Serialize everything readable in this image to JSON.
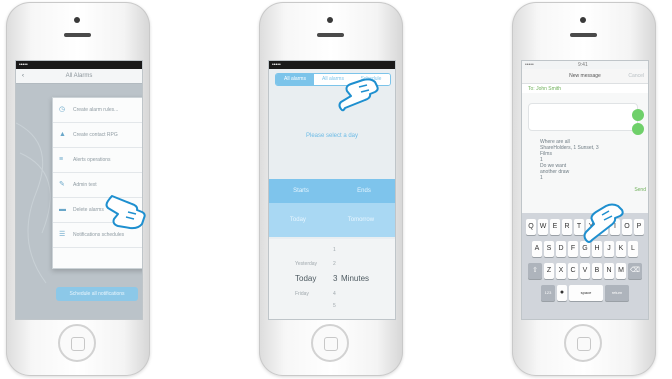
{
  "phone1": {
    "status_left": "••••• ",
    "nav_back": "‹",
    "nav_title": "All Alarms",
    "menu_items": [
      {
        "icon": "alarm-icon",
        "label": "Create alarm rules..."
      },
      {
        "icon": "person-icon",
        "label": "Create contact RPG"
      },
      {
        "icon": "alert-icon",
        "label": "Alerts operations"
      },
      {
        "icon": "edit-icon",
        "label": "Admin text"
      },
      {
        "icon": "folder-icon",
        "label": "Delete alarms"
      },
      {
        "icon": "settings-icon",
        "label": "Notifications schedules"
      }
    ],
    "bottom_button": "Schedule all notifications"
  },
  "phone2": {
    "status_left": "•••••",
    "tabs": [
      "All alarms",
      "All alarms",
      "Schedule"
    ],
    "prompt": "Please select a day",
    "band_top": {
      "left": "Starts",
      "right": "Ends"
    },
    "band_mid": {
      "left": "Today",
      "right": "Tomorrow"
    },
    "picker_rows": [
      {
        "c1": "",
        "c2": "1",
        "c3": ""
      },
      {
        "c1": "Yesterday",
        "c2": "2",
        "c3": ""
      },
      {
        "c1": "Today",
        "c2": "3",
        "c3": "Minutes"
      },
      {
        "c1": "Friday",
        "c2": "4",
        "c3": ""
      },
      {
        "c1": "",
        "c2": "5",
        "c3": ""
      }
    ]
  },
  "phone3": {
    "status_left": "•••••",
    "status_time": "9:41",
    "header_left": "",
    "header_title": "New message",
    "header_right": "Cancel",
    "to_label": "To: ",
    "to_value": "John Smith",
    "draft_text": "Where are all\nShareHolders, 1 Sunset, 3\nFilms\n1\nDo we want\nanother draw\n1",
    "send_label": "Send",
    "keyboard_rows": [
      [
        "Q",
        "W",
        "E",
        "R",
        "T",
        "Y",
        "U",
        "I",
        "O",
        "P"
      ],
      [
        "A",
        "S",
        "D",
        "F",
        "G",
        "H",
        "J",
        "K",
        "L"
      ],
      [
        "⇧",
        "Z",
        "X",
        "C",
        "V",
        "B",
        "N",
        "M",
        "⌫"
      ]
    ],
    "kb_bottom": {
      "numbers": "123",
      "space": "space",
      "return": "return"
    }
  },
  "colors": {
    "accent_blue": "#7ec4ec",
    "message_green": "#6fb05a"
  }
}
